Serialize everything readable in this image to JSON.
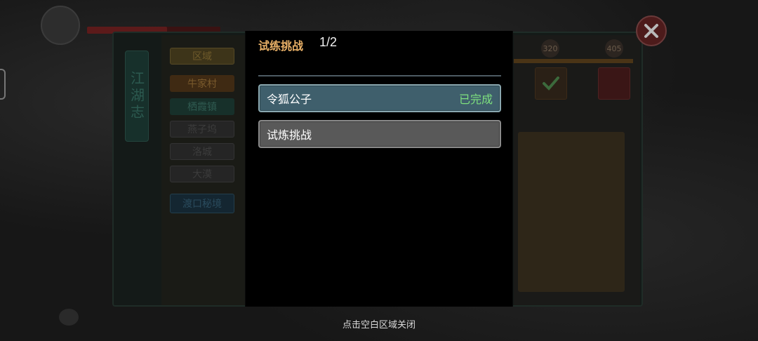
{
  "background": {
    "book_title": "江湖志",
    "region_header": "区域",
    "regions": [
      "牛家村",
      "栖霞镇",
      "燕子坞",
      "洛城",
      "大漠"
    ],
    "secret_realm": "渡口秘境",
    "progress_marks": [
      "320",
      "405"
    ]
  },
  "modal": {
    "title": "试练挑战",
    "count": "1/2",
    "rows": [
      {
        "name": "令狐公子",
        "status": "已完成"
      },
      {
        "name": "试炼挑战",
        "status": ""
      }
    ]
  },
  "footer": {
    "close_hint": "点击空白区域关闭"
  },
  "colors": {
    "title_accent": "#e8b067",
    "completed": "#7ee07e",
    "active_row": "#3f5f6c",
    "normal_row": "#595959"
  }
}
